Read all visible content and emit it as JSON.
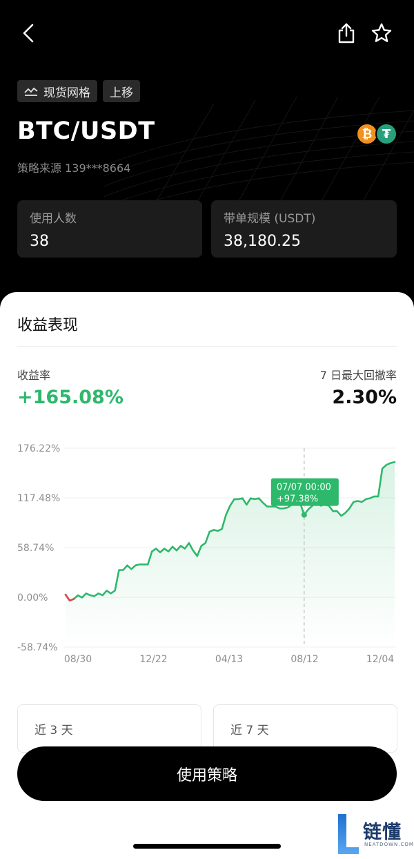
{
  "header": {
    "icons": [
      "back-icon",
      "share-icon",
      "star-icon"
    ],
    "tags": [
      {
        "icon": "grid-chart-icon",
        "label": "现货网格"
      },
      {
        "label": "上移"
      }
    ],
    "pair": "BTC/USDT",
    "source": "策略来源 139***8664"
  },
  "stats": {
    "users_label": "使用人数",
    "users_value": "38",
    "volume_label": "带单规模 (USDT)",
    "volume_value": "38,180.25"
  },
  "performance": {
    "title": "收益表现",
    "return_label": "收益率",
    "return_value": "+165.08%",
    "drawdown_label": "7 日最大回撤率",
    "drawdown_value": "2.30%"
  },
  "chart_data": {
    "type": "area",
    "y_ticks": [
      "176.22%",
      "117.48%",
      "58.74%",
      "0.00%",
      "-58.74%"
    ],
    "ylim": [
      -58.74,
      176.22
    ],
    "x_ticks": [
      "08/30",
      "12/22",
      "04/13",
      "08/12",
      "12/04"
    ],
    "tooltip": {
      "date": "07/07 00:00",
      "value": "+97.38%"
    },
    "line_color": "#2db86b",
    "negative_color": "#e0454f",
    "series": [
      {
        "values": [
          3.2,
          -3.8,
          -2,
          2.4,
          -0.3,
          4.6,
          2.4,
          1.4,
          4.6,
          2.4,
          7.9,
          4.6,
          7.9,
          32.2,
          32.2,
          37.7,
          33.3,
          37.7,
          38.8,
          38.8,
          38.8,
          54.2,
          57.5,
          53.1,
          57.5,
          54.2,
          59.7,
          55.3,
          60.8,
          57.5,
          64.1,
          55.3,
          48.7,
          60.8,
          64.1,
          77.4,
          79.6,
          78.5,
          80.7,
          97.3,
          108.3,
          115.9,
          115.9,
          117.0,
          109.4,
          117.0,
          115.9,
          117.0,
          111.6,
          107.2,
          107.2,
          107.2,
          105.0,
          105.0,
          106.1,
          109.4,
          110.5,
          111.6,
          97.4,
          103.9,
          108.3,
          114.8,
          108.3,
          109.4,
          108.3,
          101.7,
          101.7,
          96.3,
          99.6,
          105.0,
          112.7,
          113.8,
          112.7,
          115.9,
          117.0,
          119.2,
          119.2,
          152.1,
          156.5,
          158.6,
          159.7
        ]
      }
    ]
  },
  "ranges": [
    "近 3 天",
    "近 7 天"
  ],
  "cta": "使用策略",
  "watermark": {
    "text": "链懂",
    "sub": "NEATDOWN.COM"
  }
}
